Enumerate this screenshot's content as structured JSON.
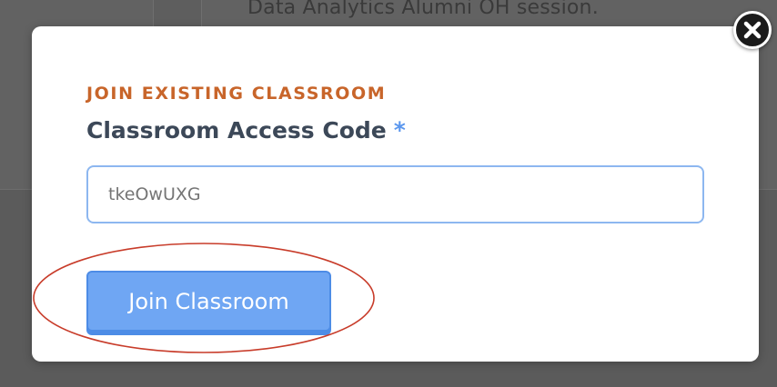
{
  "background": {
    "session_text": "Data Analytics Alumni OH session."
  },
  "modal": {
    "eyebrow": "JOIN EXISTING CLASSROOM",
    "field_label": "Classroom Access Code",
    "required_marker": "*",
    "access_code_value": "tkeOwUXG",
    "join_button_label": "Join Classroom",
    "close_icon": "close-icon"
  },
  "annotation": {
    "type": "ellipse-highlight",
    "color": "#c83c2a",
    "target": "join-classroom-button"
  }
}
